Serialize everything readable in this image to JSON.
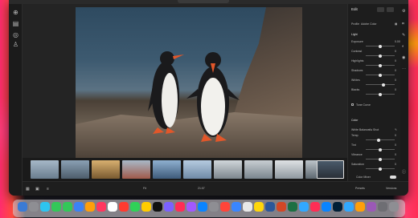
{
  "panel": {
    "title": "Edit",
    "profile_label": "Profile",
    "profile_value": "Adobe Color",
    "light_header": "Light",
    "light_sliders": [
      {
        "label": "Exposure",
        "value": "0.00",
        "level": 0.5
      },
      {
        "label": "Contrast",
        "value": "0",
        "level": 0.5
      },
      {
        "label": "Highlights",
        "value": "0",
        "level": 0.5
      },
      {
        "label": "Shadows",
        "value": "0",
        "level": 0.5
      },
      {
        "label": "Whites",
        "value": "0",
        "level": 0.6
      },
      {
        "label": "Blacks",
        "value": "0",
        "level": 0.5
      }
    ],
    "tone_curve_label": "Tone Curve",
    "color_header": "Color",
    "white_balance_label": "White Balance",
    "white_balance_value": "As Shot",
    "color_sliders": [
      {
        "label": "Temp",
        "value": "0",
        "level": 0.45
      },
      {
        "label": "Tint",
        "value": "0",
        "level": 0.5
      },
      {
        "label": "Vibrance",
        "value": "0",
        "level": 0.5
      },
      {
        "label": "Saturation",
        "value": "0",
        "level": 0.5
      }
    ],
    "color_mixer_label": "Color Mixer",
    "presets_label": "Presets",
    "versions_label": "Versions"
  },
  "bottombar": {
    "zoom": "Fit",
    "page": "21:07"
  },
  "filmstrip": {
    "thumb_colors": [
      "#8aa0b4",
      "#7a8ca0",
      "#c29a5a",
      "#a05a4a",
      "#6f8fb0",
      "#9fb6cc",
      "#c6cdd2",
      "#b8c0c6",
      "#d6dadc",
      "#a8b2ba",
      "#3a4a5a"
    ]
  },
  "dock": {
    "icon_colors": [
      "#3a7bd5",
      "#8e8e93",
      "#2ec4f0",
      "#34c759",
      "#34c759",
      "#3b82f6",
      "#ff9f0a",
      "#ff375f",
      "#ffffff",
      "#ff3b30",
      "#30d158",
      "#ffcc00",
      "#111111",
      "#7b61ff",
      "#ff2d55",
      "#a259ff",
      "#0a84ff",
      "#8e8e93",
      "#ff453a",
      "#3a86ff",
      "#e8e8e8",
      "#ffd60a",
      "#2b579a",
      "#d24726",
      "#1d6f42",
      "#31a8ff",
      "#ff2d55",
      "#0a84ff",
      "#001e36",
      "#31a8ff",
      "#ff9f0a",
      "#9b59b6",
      "#6e6e73",
      "#8e8e93"
    ]
  },
  "colors": {
    "accent": "#31a8ff",
    "window_bg": "#1e1e1e"
  }
}
